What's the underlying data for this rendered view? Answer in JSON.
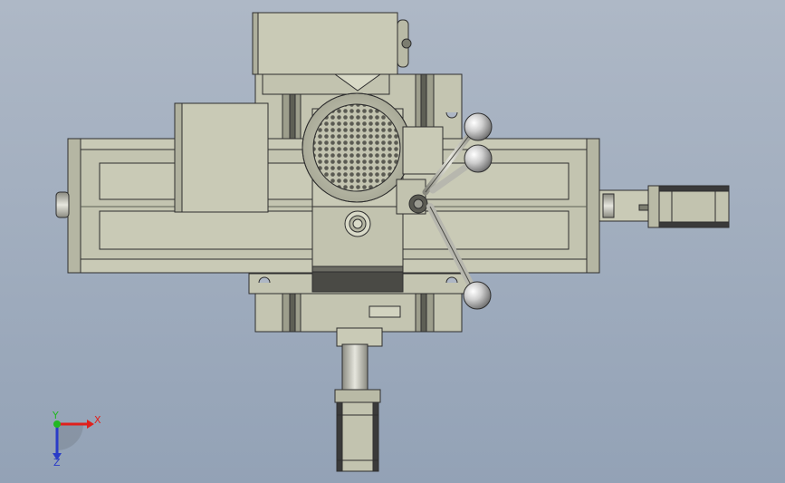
{
  "viewport": {
    "background_top": "#aeb8c6",
    "background_bottom": "#93a2b6"
  },
  "model": {
    "part_color": "#c9cab6",
    "part_shadow": "#9d9e8c",
    "edge_color": "#2e2e2e",
    "chrome_color": "#d8d8d8",
    "dark_color": "#3a3a3a"
  },
  "triad": {
    "x_label": "X",
    "y_label": "Y",
    "z_label": "Z",
    "x_color": "#e0201c",
    "y_color": "#22b822",
    "z_color": "#2a3cc8"
  }
}
